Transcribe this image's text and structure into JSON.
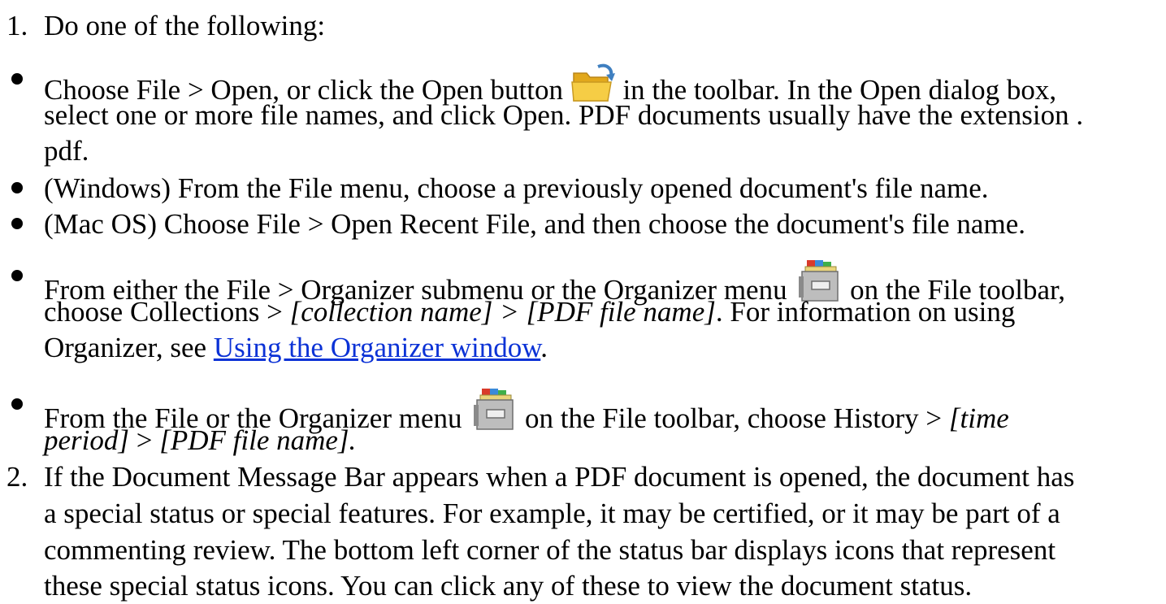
{
  "step1": {
    "number": "1.",
    "text": "Do one of the following:"
  },
  "bullet_open": {
    "line1_a": "Choose File > Open, or click the Open button",
    "line1_b": "in the toolbar. In the Open dialog box,",
    "line2": "select one or more file names, and click Open. PDF documents usually have the extension .",
    "line3": "pdf.",
    "icon": "open-folder-icon"
  },
  "bullet_windows": {
    "text": "(Windows) From the File menu, choose a previously opened document's file name."
  },
  "bullet_mac": {
    "text": "(Mac OS) Choose File > Open Recent File, and then choose the document's file name."
  },
  "bullet_organizer": {
    "line1_a": "From either the File > Organizer submenu or the Organizer menu",
    "line1_b": "on the File toolbar,",
    "line2_a": "choose Collections > ",
    "line2_b": "[collection name]",
    "line2_c": " > ",
    "line2_d": "[PDF file name]",
    "line2_e": ". For information on using",
    "line3_a": "Organizer, see ",
    "line3_link": "Using the Organizer window",
    "line3_b": ".",
    "icon": "organizer-icon"
  },
  "bullet_history": {
    "line1_a": "From the File or the Organizer menu",
    "line1_b": "on the File toolbar, choose History > ",
    "line1_c": "[time",
    "line2_a": "period]",
    "line2_b": " > ",
    "line2_c": "[PDF file name].",
    "icon": "organizer-icon"
  },
  "step2": {
    "number": "2.",
    "line1": "If the Document Message Bar appears when a PDF document is opened, the document has",
    "line2": "a special status or special features. For example, it may be certified, or it may be part of a",
    "line3": "commenting review. The bottom left corner of the status bar displays icons that represent",
    "line4": "these special status icons. You can click any of these to view the document status."
  },
  "colors": {
    "link": "#0b32d6",
    "folder": "#f2c230",
    "arrow": "#3f7fc0"
  }
}
